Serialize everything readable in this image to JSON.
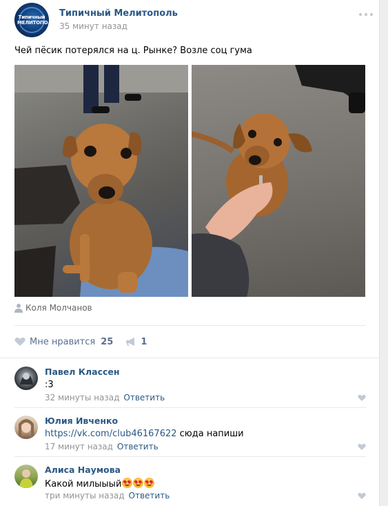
{
  "post": {
    "group_name": "Типичный Мелитополь",
    "avatar_text": "Типичный МЕЛИТОПОЛЬ",
    "time": "35 минут назад",
    "text": "Чей пёсик потерялся на ц. Рынке? Возле соц гума",
    "author": "Коля Молчанов",
    "like_label": "Мне нравится",
    "like_count": "25",
    "share_count": "1"
  },
  "comments": [
    {
      "author": "Павел Классен",
      "text": ":3",
      "link": "",
      "time": "32 минуты назад",
      "reply": "Ответить"
    },
    {
      "author": "Юлия Ивченко",
      "text": "сюда напиши",
      "link": "https://vk.com/club46167622",
      "time": "17 минут назад",
      "reply": "Ответить"
    },
    {
      "author": "Алиса Наумова",
      "text": "Какой милыыый",
      "link": "",
      "time": "три минуты назад",
      "reply": "Ответить"
    }
  ],
  "icons": {
    "more": "more-dots-icon",
    "user": "user-icon",
    "like": "heart-icon",
    "share": "megaphone-icon"
  },
  "colors": {
    "link": "#2a5885",
    "meta": "#939393",
    "action": "#5a7090",
    "divider": "#e7e8ec"
  }
}
